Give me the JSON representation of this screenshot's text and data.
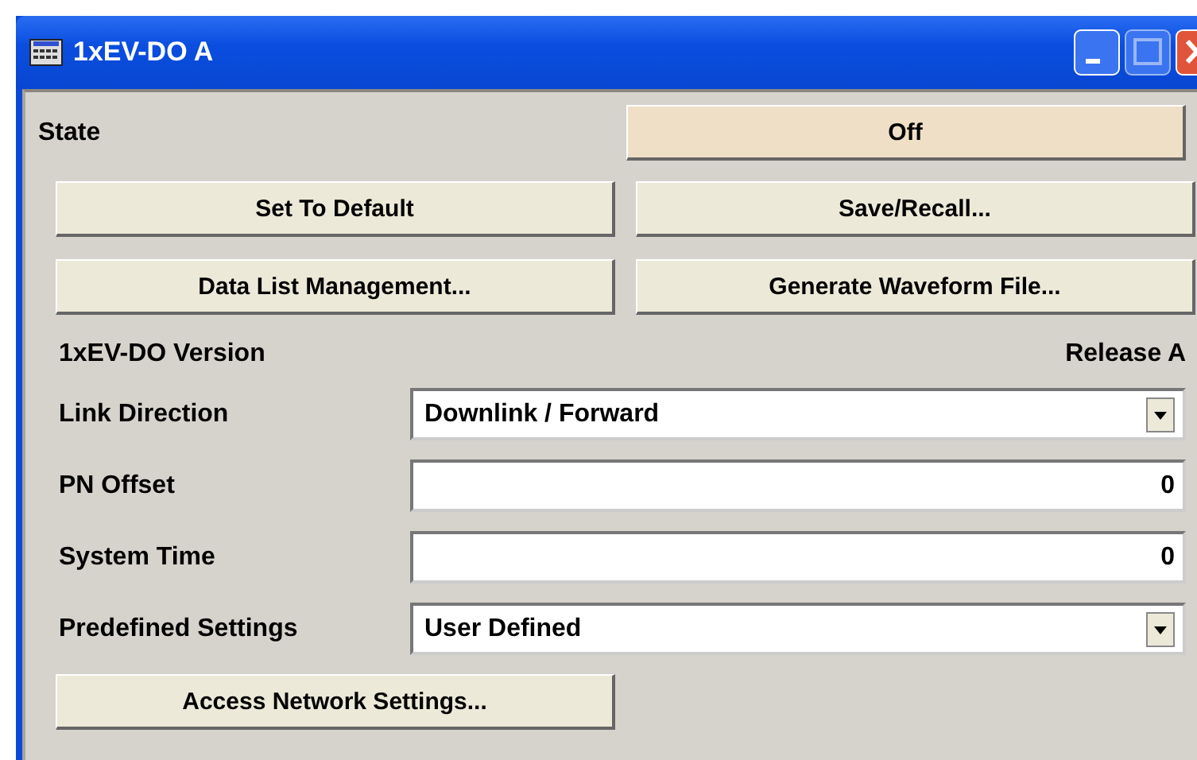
{
  "window": {
    "title": "1xEV-DO A"
  },
  "state": {
    "label": "State",
    "button": "Off"
  },
  "buttons": [
    {
      "label": "Set To Default"
    },
    {
      "label": "Save/Recall..."
    },
    {
      "label": "Data List Management..."
    },
    {
      "label": "Generate Waveform File..."
    }
  ],
  "version": {
    "label": "1xEV-DO Version",
    "value": "Release A"
  },
  "settings": [
    {
      "label": "Link Direction",
      "kind": "dropdown",
      "value": "Downlink / Forward"
    },
    {
      "label": "PN Offset",
      "kind": "number",
      "value": "0"
    },
    {
      "label": "System Time",
      "kind": "number",
      "value": "0"
    },
    {
      "label": "Predefined Settings",
      "kind": "dropdown",
      "value": "User Defined"
    }
  ],
  "bottom_button": {
    "label": "Access Network Settings..."
  }
}
